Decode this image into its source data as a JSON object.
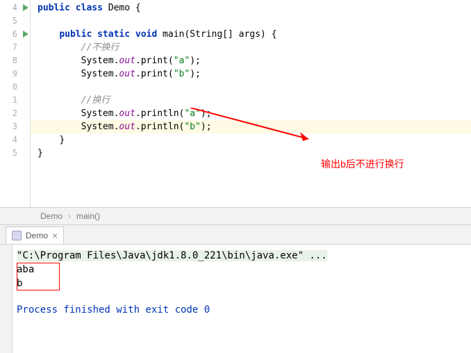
{
  "gutter": {
    "lines": [
      "4",
      "5",
      "6",
      "7",
      "8",
      "9",
      "0",
      "1",
      "2",
      "3",
      "4",
      "5"
    ]
  },
  "code": {
    "class_decl_kw1": "public",
    "class_decl_kw2": "class",
    "class_name": "Demo",
    "open_brace": " {",
    "method_kw1": "public",
    "method_kw2": "static",
    "method_kw3": "void",
    "method_name": "main",
    "method_params": "(String[] args) {",
    "comment1": "//不换行",
    "sys": "System",
    "dot": ".",
    "out": "out",
    "print": "print",
    "println": "println",
    "str_a": "\"a\"",
    "str_b": "\"b\"",
    "paren_open": "(",
    "paren_close": ")",
    "semi": ";",
    "comment2": "//换行",
    "close_brace": "}"
  },
  "annotation": {
    "text": "输出b后不进行换行"
  },
  "breadcrumb": {
    "item1": "Demo",
    "item2": "main()"
  },
  "console": {
    "tab_name": "Demo",
    "command": "\"C:\\Program Files\\Java\\jdk1.8.0_221\\bin\\java.exe\" ...",
    "output_line1": "aba",
    "output_line2": "b",
    "process_msg": "Process finished with exit code 0"
  }
}
